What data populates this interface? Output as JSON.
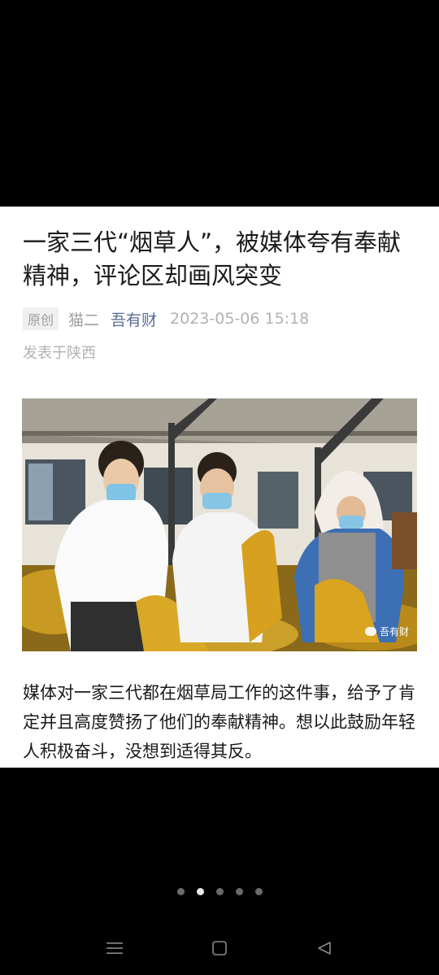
{
  "article": {
    "title": "一家三代“烟草人”，被媒体夸有奉献精神，评论区却画风突变",
    "badge": "原创",
    "author": "猫二",
    "account": "吾有财",
    "datetime": "2023-05-06 15:18",
    "location": "发表于陕西",
    "photo_watermark": "吾有财",
    "body": "媒体对一家三代都在烟草局工作的这件事，给予了肯定并且高度赞扬了他们的奉献精神。想以此鼓励年轻人积极奋斗，没想到适得其反。"
  },
  "pager": {
    "count": 5,
    "active_index": 1
  },
  "navbar": {
    "icons": [
      "menu-icon",
      "home-icon",
      "back-icon"
    ]
  },
  "colors": {
    "link": "#576b95",
    "meta": "#b2b2b2",
    "text": "#1a1a1a"
  }
}
